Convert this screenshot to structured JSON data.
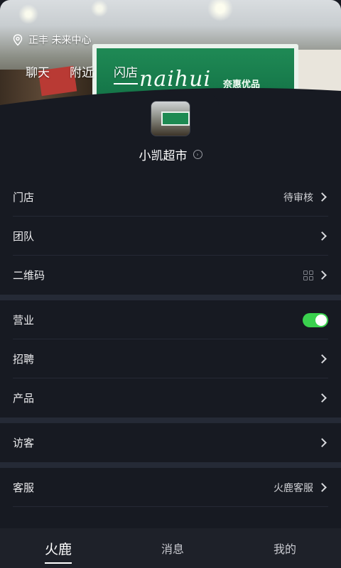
{
  "header": {
    "location": "正丰 未来中心",
    "tabs": [
      {
        "label": "聊天",
        "active": false
      },
      {
        "label": "附近",
        "active": false
      },
      {
        "label": "闪店",
        "active": true
      }
    ],
    "sign_text": "naihui",
    "sign_subtext": "奈惠优品"
  },
  "store": {
    "name": "小凯超市"
  },
  "menu": {
    "store": {
      "label": "门店",
      "value": "待审核"
    },
    "team": {
      "label": "团队"
    },
    "qrcode": {
      "label": "二维码"
    },
    "business": {
      "label": "营业",
      "enabled": true
    },
    "recruit": {
      "label": "招聘"
    },
    "product": {
      "label": "产品"
    },
    "visitor": {
      "label": "访客"
    },
    "service": {
      "label": "客服",
      "value": "火鹿客服"
    }
  },
  "bottom_nav": [
    {
      "label": "火鹿",
      "active": true
    },
    {
      "label": "消息",
      "active": false
    },
    {
      "label": "我的",
      "active": false
    }
  ],
  "colors": {
    "background": "#171a22",
    "toggle_on": "#3ad14e",
    "store_sign": "#1f8a55"
  }
}
